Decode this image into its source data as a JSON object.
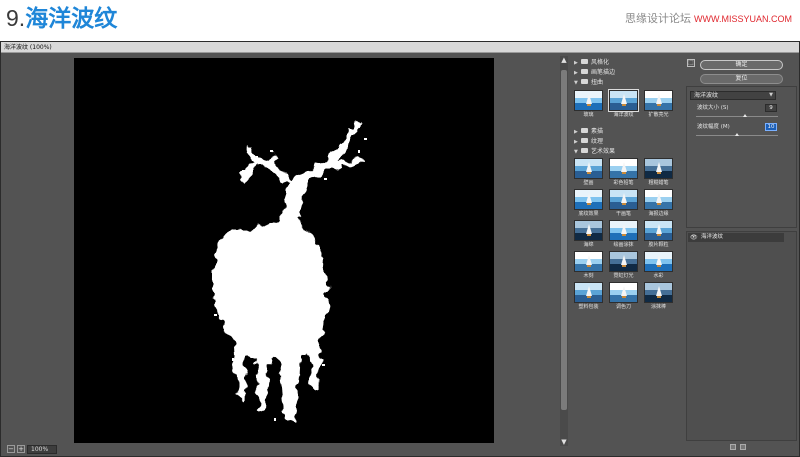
{
  "header": {
    "step_number": "9.",
    "step_title": "海洋波纹",
    "watermark_cn": "思缘设计论坛",
    "watermark_site": "WWW.MISSYUAN.COM"
  },
  "window": {
    "title": "海洋波纹 (100%)"
  },
  "statusbar": {
    "zoom_out": "−",
    "zoom_in": "+",
    "zoom": "100%"
  },
  "filter_list": {
    "categories": {
      "stylize": "风格化",
      "brush_strokes": "画笔描边",
      "distort": "扭曲",
      "sketch": "素描",
      "texture": "纹理",
      "artistic": "艺术效果"
    },
    "distort_filters": [
      "玻璃",
      "海洋波纹",
      "扩散亮光"
    ],
    "artistic_filters": [
      "壁画",
      "彩色铅笔",
      "粗糙蜡笔",
      "底纹效果",
      "干画笔",
      "海报边缘",
      "海绵",
      "绘画涂抹",
      "胶片颗粒",
      "木刻",
      "霓虹灯光",
      "水彩",
      "塑料包装",
      "调色刀",
      "涂抹棒"
    ],
    "selected": "海洋波纹"
  },
  "settings": {
    "ok": "确定",
    "reset": "复位",
    "selected_filter": "海洋波纹",
    "ripple_size_label": "波纹大小 (S)",
    "ripple_size_value": "9",
    "ripple_size_fraction": 0.6,
    "ripple_magnitude_label": "波纹幅度 (M)",
    "ripple_magnitude_value": "10",
    "ripple_magnitude_fraction": 0.5
  },
  "layers": {
    "active": "海洋波纹"
  },
  "colors": {
    "title_blue": "#1f86d8",
    "panel_gray": "#535353",
    "canvas_black": "#000000",
    "watermark_red": "#e0282f"
  }
}
